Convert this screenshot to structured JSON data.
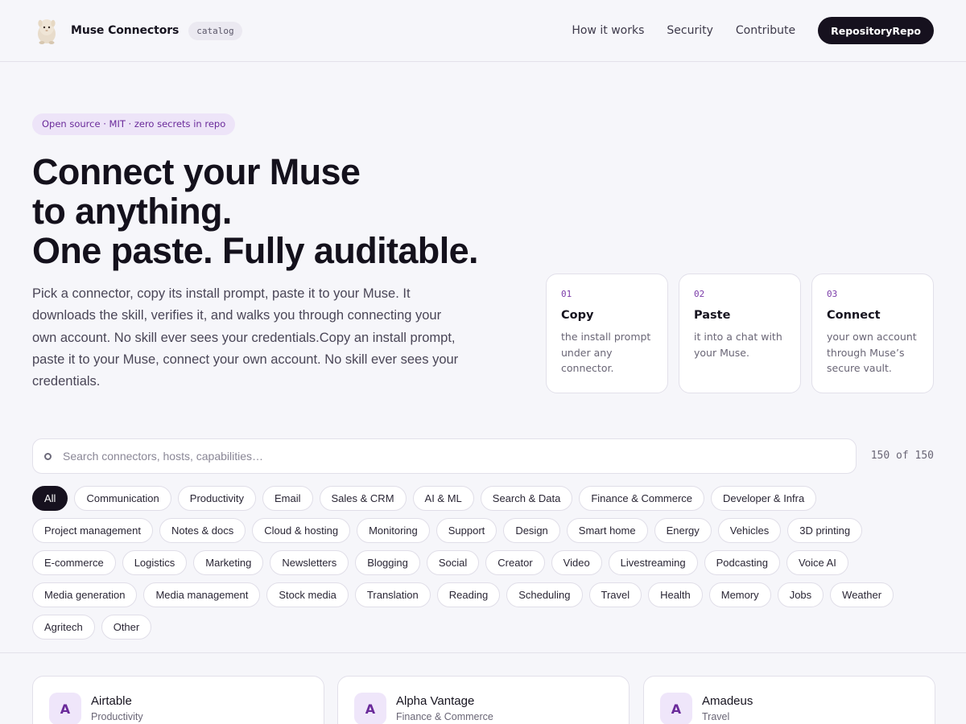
{
  "header": {
    "brand_name": "Muse Connectors",
    "badge": "catalog",
    "mascot_icon": "mascot-icon",
    "nav": [
      {
        "label": "How it works"
      },
      {
        "label": "Security"
      },
      {
        "label": "Contribute"
      }
    ],
    "repo_button": "RepositoryRepo"
  },
  "hero": {
    "pill": "Open source · MIT · zero secrets in repo",
    "headline": [
      "Connect your Muse",
      "to anything.",
      "One paste. Fully auditable."
    ],
    "lede": "Pick a connector, copy its install prompt, paste it to your Muse. It downloads the skill, verifies it, and walks you through connecting your own account. No skill ever sees your credentials.Copy an install prompt, paste it to your Muse, connect your own account. No skill ever sees your credentials."
  },
  "steps": [
    {
      "num": "01",
      "title": "Copy",
      "desc": "the install prompt under any connector."
    },
    {
      "num": "02",
      "title": "Paste",
      "desc": "it into a chat with your Muse."
    },
    {
      "num": "03",
      "title": "Connect",
      "desc": "your own account through Muse’s secure vault."
    }
  ],
  "search": {
    "placeholder": "Search connectors, hosts, capabilities…",
    "value": "",
    "count": "150 of 150"
  },
  "filters": {
    "active": "All",
    "rows": [
      [
        "All",
        "Communication",
        "Productivity",
        "Email",
        "Sales & CRM",
        "AI & ML",
        "Search & Data",
        "Finance & Commerce",
        "Developer & Infra"
      ],
      [
        "Project management",
        "Notes & docs",
        "Cloud & hosting",
        "Monitoring",
        "Support",
        "Design",
        "Smart home",
        "Energy",
        "Vehicles",
        "3D printing"
      ],
      [
        "E-commerce",
        "Logistics",
        "Marketing",
        "Newsletters",
        "Blogging",
        "Social",
        "Creator",
        "Video",
        "Livestreaming",
        "Podcasting",
        "Voice AI"
      ],
      [
        "Media generation",
        "Media management",
        "Stock media",
        "Translation",
        "Reading",
        "Scheduling",
        "Travel",
        "Health",
        "Memory",
        "Jobs",
        "Weather"
      ],
      [
        "Agritech",
        "Other"
      ]
    ]
  },
  "connectors": [
    {
      "initial": "A",
      "name": "Airtable",
      "category": "Productivity"
    },
    {
      "initial": "A",
      "name": "Alpha Vantage",
      "category": "Finance & Commerce"
    },
    {
      "initial": "A",
      "name": "Amadeus",
      "category": "Travel"
    }
  ],
  "colors": {
    "background": "#f6f6fa",
    "accent": "#6a2a9a",
    "accent_soft": "#ede4f8",
    "dark": "#16111e"
  }
}
